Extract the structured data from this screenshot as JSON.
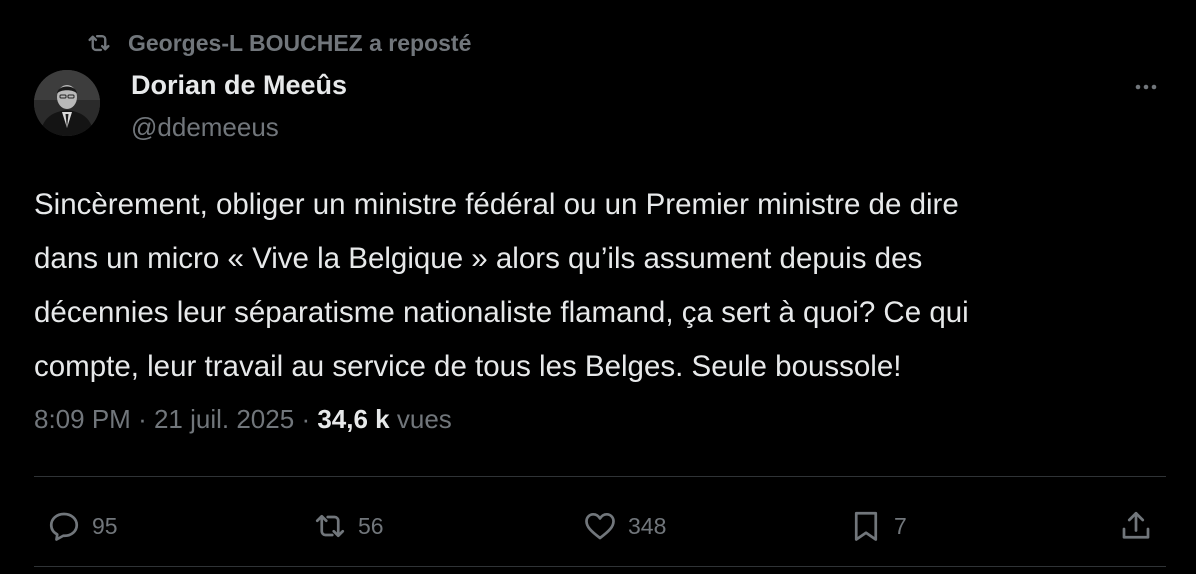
{
  "repost": {
    "text": "Georges-L BOUCHEZ a reposté",
    "icon": "repost-icon"
  },
  "author": {
    "name": "Dorian de Meeûs",
    "handle": "@ddemeeus",
    "avatar": "avatar"
  },
  "more_icon": "more-horizontal-icon",
  "tweet": {
    "lines": [
      "Sincèrement, obliger un ministre fédéral ou un Premier ministre de dire",
      "dans un micro « Vive la Belgique » alors qu’ils assument depuis des",
      "décennies leur séparatisme nationaliste flamand, ça sert à quoi? Ce qui",
      "compte, leur travail au service de tous les Belges. Seule boussole!"
    ]
  },
  "meta": {
    "time": "8:09 PM",
    "separator": "·",
    "date": "21 juil. 2025",
    "views_count": "34,6 k",
    "views_label": "vues"
  },
  "actions": {
    "replies": "95",
    "reposts": "56",
    "likes": "348",
    "bookmarks": "7"
  },
  "colors": {
    "background": "#000000",
    "text_primary": "#e7e9ea",
    "text_secondary": "#71767b",
    "divider": "#2f3336"
  }
}
